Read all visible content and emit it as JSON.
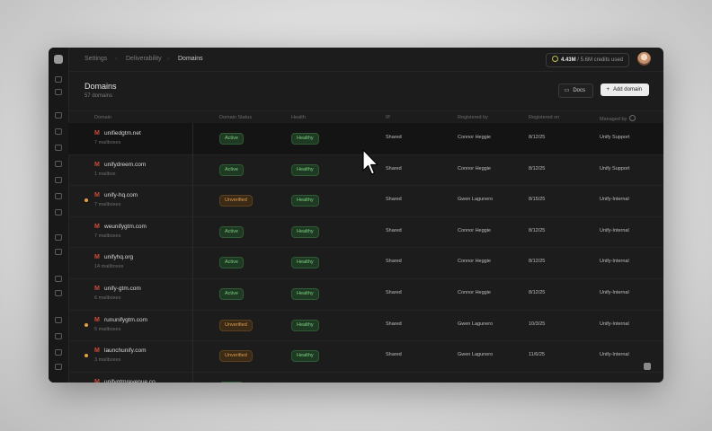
{
  "breadcrumb": [
    "Settings",
    "Deliverability",
    "Domains"
  ],
  "credits": {
    "used": "4.43M",
    "rest": "/ 5.6M credits used"
  },
  "page": {
    "title": "Domains",
    "count": "57 domains"
  },
  "actions": {
    "docs": "Docs",
    "add": "Add domain"
  },
  "columns": [
    "Domain",
    "Domain Status",
    "Health",
    "IP",
    "Registered by",
    "Registered on",
    "Managed by"
  ],
  "rows": [
    {
      "domain": "unifiedgtm.net",
      "mailboxes": "7 mailboxes",
      "status": "Active",
      "health": "Healthy",
      "ip": "Shared",
      "registered_by": "Connor Heggie",
      "registered_on": "8/12/25",
      "managed_by": "Unify Support",
      "dot": false,
      "hover": true
    },
    {
      "domain": "unifydreem.com",
      "mailboxes": "1 mailbox",
      "status": "Active",
      "health": "Healthy",
      "ip": "Shared",
      "registered_by": "Connor Heggie",
      "registered_on": "8/12/25",
      "managed_by": "Unify Support",
      "dot": false,
      "hover": false
    },
    {
      "domain": "unify-hq.com",
      "mailboxes": "7 mailboxes",
      "status": "Unverified",
      "health": "Healthy",
      "ip": "Shared",
      "registered_by": "Gwen Lagunero",
      "registered_on": "8/15/25",
      "managed_by": "Unify-Internal",
      "dot": true,
      "hover": false
    },
    {
      "domain": "weunifygtm.com",
      "mailboxes": "7 mailboxes",
      "status": "Active",
      "health": "Healthy",
      "ip": "Shared",
      "registered_by": "Connor Heggie",
      "registered_on": "8/12/25",
      "managed_by": "Unify-Internal",
      "dot": false,
      "hover": false
    },
    {
      "domain": "unifyhq.org",
      "mailboxes": "14 mailboxes",
      "status": "Active",
      "health": "Healthy",
      "ip": "Shared",
      "registered_by": "Connor Heggie",
      "registered_on": "8/12/25",
      "managed_by": "Unify-Internal",
      "dot": false,
      "hover": false
    },
    {
      "domain": "unify-gtm.com",
      "mailboxes": "6 mailboxes",
      "status": "Active",
      "health": "Healthy",
      "ip": "Shared",
      "registered_by": "Connor Heggie",
      "registered_on": "8/12/25",
      "managed_by": "Unify-Internal",
      "dot": false,
      "hover": false
    },
    {
      "domain": "rununifygtm.com",
      "mailboxes": "5 mailboxes",
      "status": "Unverified",
      "health": "Healthy",
      "ip": "Shared",
      "registered_by": "Gwen Lagunero",
      "registered_on": "10/3/25",
      "managed_by": "Unify-Internal",
      "dot": true,
      "hover": false
    },
    {
      "domain": "launchunify.com",
      "mailboxes": "3 mailboxes",
      "status": "Unverified",
      "health": "Healthy",
      "ip": "Shared",
      "registered_by": "Gwen Lagunero",
      "registered_on": "11/6/25",
      "managed_by": "Unify-Internal",
      "dot": true,
      "hover": false
    },
    {
      "domain": "unifygtmrevenue.co",
      "mailboxes": "",
      "status": "Active",
      "health": "",
      "ip": "",
      "registered_by": "",
      "registered_on": "",
      "managed_by": "",
      "dot": false,
      "hover": false
    }
  ]
}
